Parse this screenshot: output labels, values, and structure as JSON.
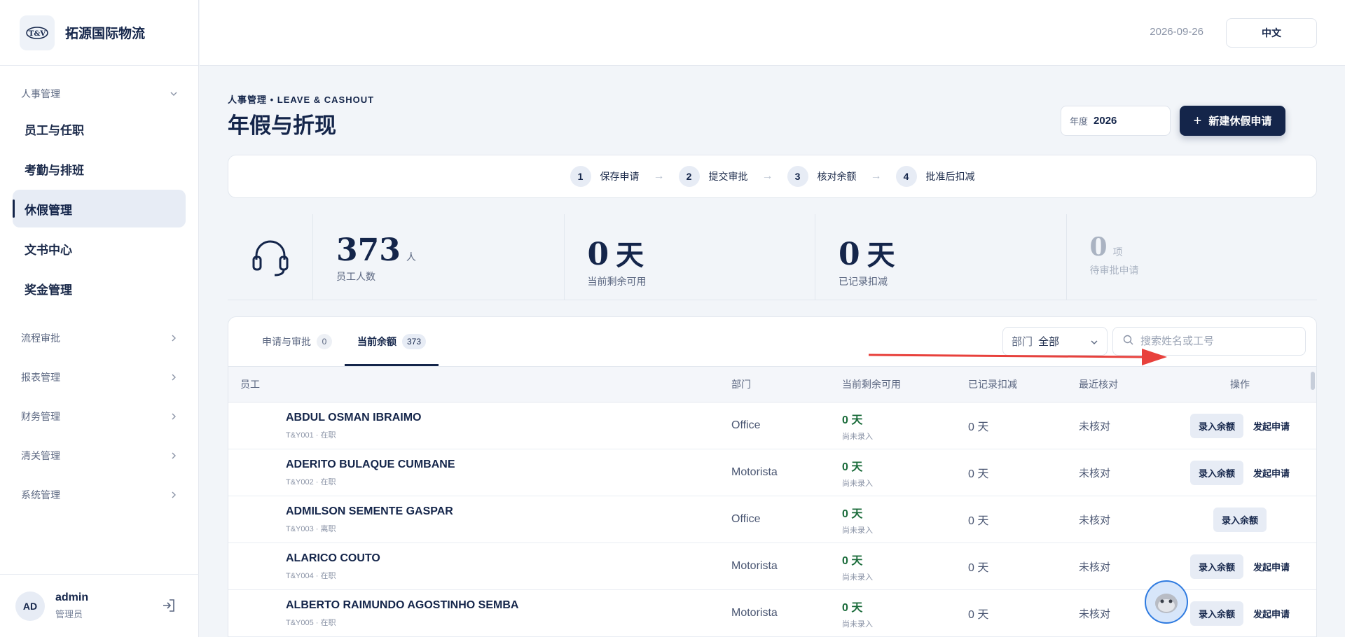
{
  "brand": {
    "logo_text": "T&V",
    "name": "拓源国际物流"
  },
  "sidebar": {
    "group_hr": "人事管理",
    "items": [
      {
        "label": "员工与任职"
      },
      {
        "label": "考勤与排班"
      },
      {
        "label": "休假管理"
      },
      {
        "label": "文书中心"
      },
      {
        "label": "奖金管理"
      }
    ],
    "groups": [
      {
        "label": "流程审批"
      },
      {
        "label": "报表管理"
      },
      {
        "label": "财务管理"
      },
      {
        "label": "清关管理"
      },
      {
        "label": "系统管理"
      }
    ]
  },
  "user": {
    "initials": "AD",
    "name": "admin",
    "role": "管理员"
  },
  "topbar": {
    "date": "2026-09-26",
    "language": "中文"
  },
  "header": {
    "breadcrumb": "人事管理 • LEAVE & CASHOUT",
    "title": "年假与折现",
    "year_label": "年度",
    "year_value": "2026",
    "new_button": "新建休假申请"
  },
  "steps": [
    {
      "num": "1",
      "label": "保存申请"
    },
    {
      "num": "2",
      "label": "提交审批"
    },
    {
      "num": "3",
      "label": "核对余额"
    },
    {
      "num": "4",
      "label": "批准后扣减"
    }
  ],
  "stats": [
    {
      "value": "373",
      "unit": "人",
      "label": "员工人数"
    },
    {
      "value": "0",
      "unit": "天",
      "label": "当前剩余可用"
    },
    {
      "value": "0",
      "unit": "天",
      "label": "已记录扣减"
    },
    {
      "value": "0",
      "unit": "项",
      "label": "待审批申请"
    }
  ],
  "tabs": [
    {
      "label": "申请与审批",
      "count": "0"
    },
    {
      "label": "当前余额",
      "count": "373"
    }
  ],
  "filters": {
    "dept_label": "部门",
    "dept_value": "全部",
    "search_placeholder": "搜索姓名或工号"
  },
  "table": {
    "headers": [
      "员工",
      "部门",
      "当前剩余可用",
      "已记录扣减",
      "最近核对",
      "操作"
    ],
    "rows": [
      {
        "name": "ABDUL OSMAN IBRAIMO",
        "sub": "T&Y001 · 在职",
        "dept": "Office",
        "avail": "0 天",
        "avail_sub": "尚未录入",
        "used": "0 天",
        "check": "未核对",
        "op1": "录入余额",
        "op2": "发起申请"
      },
      {
        "name": "ADERITO BULAQUE CUMBANE",
        "sub": "T&Y002 · 在职",
        "dept": "Motorista",
        "avail": "0 天",
        "avail_sub": "尚未录入",
        "used": "0 天",
        "check": "未核对",
        "op1": "录入余额",
        "op2": "发起申请"
      },
      {
        "name": "ADMILSON SEMENTE GASPAR",
        "sub": "T&Y003 · 离职",
        "dept": "Office",
        "avail": "0 天",
        "avail_sub": "尚未录入",
        "used": "0 天",
        "check": "未核对",
        "op1": "录入余额",
        "op2": ""
      },
      {
        "name": "ALARICO COUTO",
        "sub": "T&Y004 · 在职",
        "dept": "Motorista",
        "avail": "0 天",
        "avail_sub": "尚未录入",
        "used": "0 天",
        "check": "未核对",
        "op1": "录入余额",
        "op2": "发起申请"
      },
      {
        "name": "ALBERTO RAIMUNDO AGOSTINHO SEMBA",
        "sub": "T&Y005 · 在职",
        "dept": "Motorista",
        "avail": "0 天",
        "avail_sub": "尚未录入",
        "used": "0 天",
        "check": "未核对",
        "op1": "录入余额",
        "op2": "发起申请"
      }
    ]
  },
  "colors": {
    "primary": "#14254a",
    "accent_green": "#1a6b3a",
    "annotation_arrow": "#e8413c"
  },
  "icons": [
    "headset-icon",
    "search-icon",
    "chevron-down-icon",
    "chevron-right-icon",
    "logout-icon",
    "plus-icon",
    "assistant-bot-icon"
  ]
}
